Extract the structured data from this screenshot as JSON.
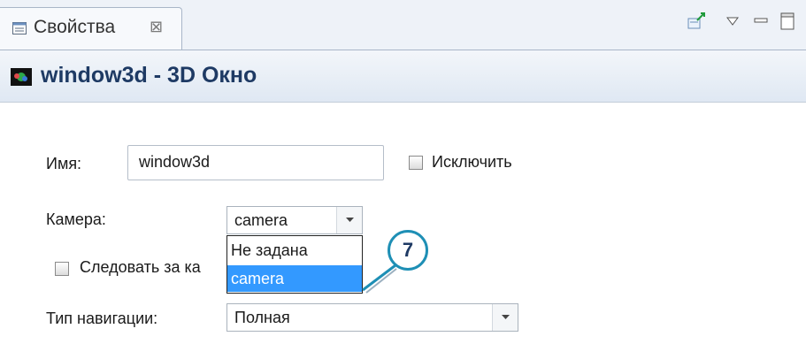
{
  "tab": {
    "label": "Свойства",
    "close_glyph": "⊠",
    "icon": "properties-icon"
  },
  "toolbar": {
    "buttons": [
      "pin-icon",
      "view-menu-icon",
      "minimize-icon",
      "maximize-icon"
    ]
  },
  "header": {
    "title": "window3d - 3D Окно",
    "icon": "window3d-icon"
  },
  "form": {
    "name_label": "Имя:",
    "name_value": "window3d",
    "exclude_label": "Исключить",
    "camera_label": "Камера:",
    "camera_value": "camera",
    "camera_options": [
      "Не задана",
      "camera"
    ],
    "follow_label": "Следовать за ка",
    "nav_label": "Тип навигации:",
    "nav_value": "Полная"
  },
  "callout": {
    "number": "7"
  },
  "colors": {
    "accent": "#3399ff",
    "callout_border": "#1e8fb5",
    "title": "#1e3a64"
  }
}
